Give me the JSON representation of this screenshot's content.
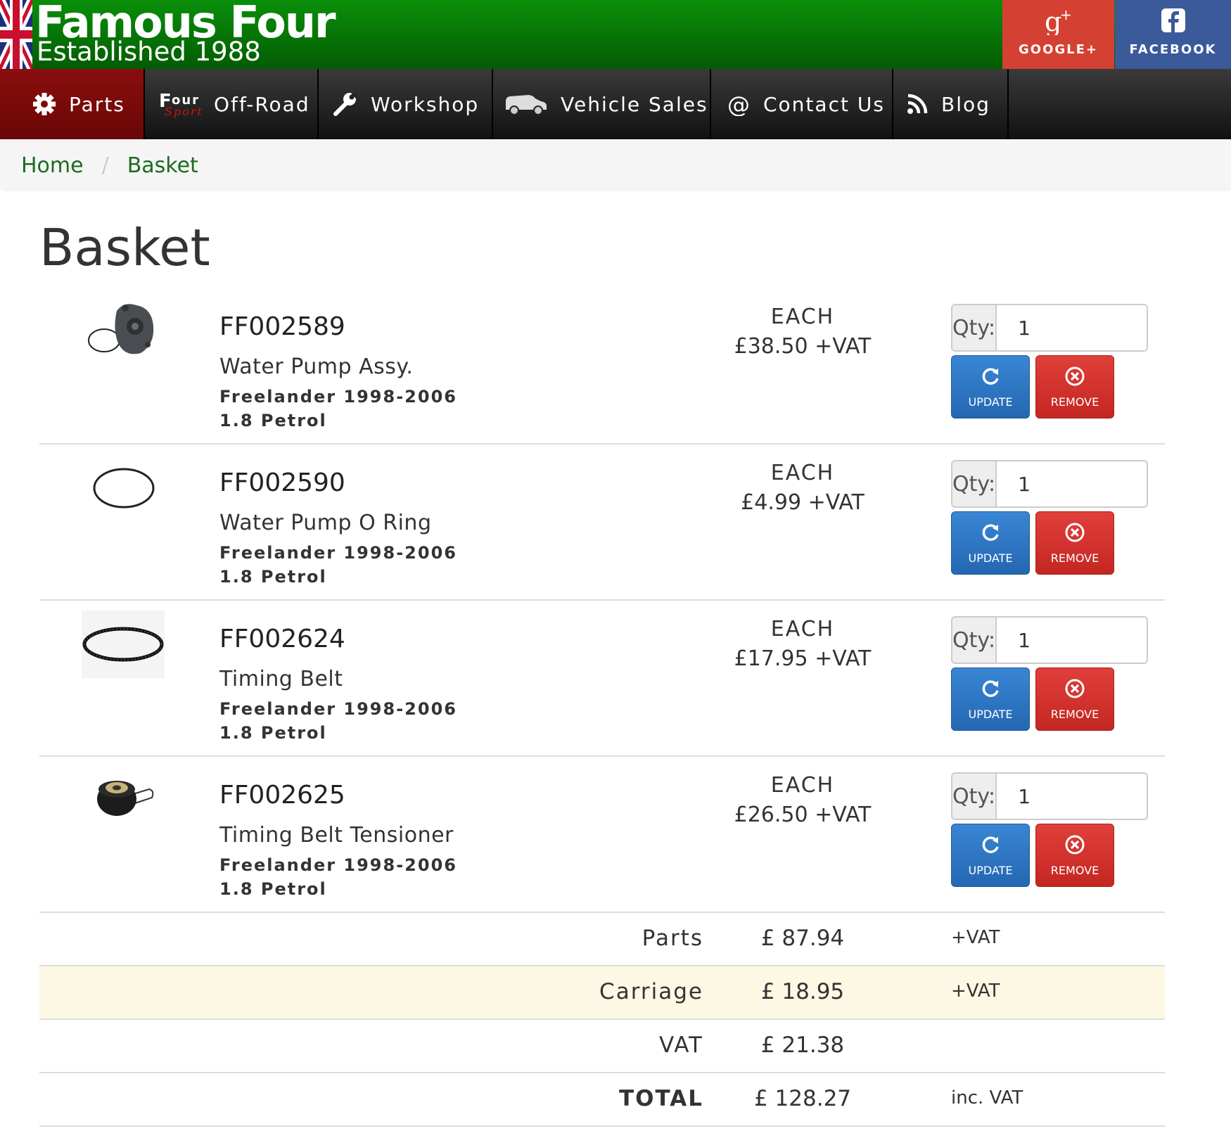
{
  "brand": {
    "title": "Famous Four",
    "subtitle": "Established 1988"
  },
  "social": {
    "google_label": "GOOGLE+",
    "facebook_label": "FACEBOOK"
  },
  "nav": {
    "items": [
      {
        "label": "Parts",
        "icon": "gear-icon"
      },
      {
        "label": "Off-Road",
        "icon": "four-sport-logo"
      },
      {
        "label": "Workshop",
        "icon": "wrench-icon"
      },
      {
        "label": "Vehicle Sales",
        "icon": "vehicle-icon"
      },
      {
        "label": "Contact Us",
        "icon": "at-icon"
      },
      {
        "label": "Blog",
        "icon": "rss-icon"
      }
    ]
  },
  "breadcrumb": {
    "home": "Home",
    "separator": "/",
    "current": "Basket"
  },
  "page": {
    "title": "Basket"
  },
  "basket": {
    "each_label": "EACH",
    "qty_label": "Qty:",
    "update_label": "UPDATE",
    "remove_label": "REMOVE",
    "items": [
      {
        "code": "FF002589",
        "name": "Water Pump Assy.",
        "model": "Freelander 1998-2006",
        "engine": "1.8 Petrol",
        "price": "£38.50 +VAT",
        "qty": "1"
      },
      {
        "code": "FF002590",
        "name": "Water Pump O Ring",
        "model": "Freelander 1998-2006",
        "engine": "1.8 Petrol",
        "price": "£4.99 +VAT",
        "qty": "1"
      },
      {
        "code": "FF002624",
        "name": "Timing Belt",
        "model": "Freelander 1998-2006",
        "engine": "1.8 Petrol",
        "price": "£17.95 +VAT",
        "qty": "1"
      },
      {
        "code": "FF002625",
        "name": "Timing Belt Tensioner",
        "model": "Freelander 1998-2006",
        "engine": "1.8 Petrol",
        "price": "£26.50 +VAT",
        "qty": "1"
      }
    ]
  },
  "totals": [
    {
      "label": "Parts",
      "value": "£ 87.94",
      "note": "+VAT"
    },
    {
      "label": "Carriage",
      "value": "£ 18.95",
      "note": "+VAT"
    },
    {
      "label": "VAT",
      "value": "£ 21.38",
      "note": ""
    },
    {
      "label": "TOTAL",
      "value": "£ 128.27",
      "note": "inc. VAT"
    }
  ],
  "colors": {
    "header_green": "#067306",
    "nav_dark": "#222222",
    "nav_active": "#7a0b0b",
    "update_blue": "#2467b2",
    "remove_red": "#c42622",
    "google_red": "#d44132",
    "facebook_blue": "#3b5a9a",
    "highlight_row": "#fcf8e3"
  }
}
